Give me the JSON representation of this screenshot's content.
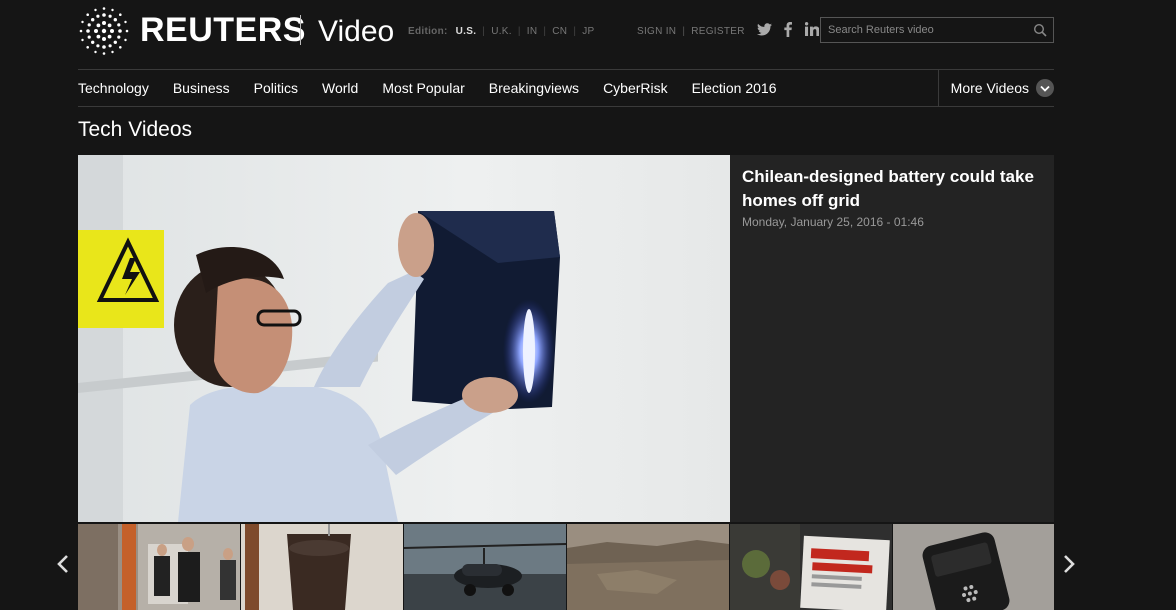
{
  "header": {
    "brand": "REUTERS",
    "section": "Video",
    "edition": {
      "label": "Edition:",
      "items": [
        "U.S.",
        "U.K.",
        "IN",
        "CN",
        "JP"
      ],
      "active": "U.S."
    },
    "auth": {
      "sign_in": "SIGN IN",
      "register": "REGISTER"
    },
    "social_icons": [
      "twitter-icon",
      "facebook-icon",
      "linkedin-icon"
    ],
    "search": {
      "placeholder": "Search Reuters video",
      "value": ""
    }
  },
  "nav": {
    "items": [
      "Technology",
      "Business",
      "Politics",
      "World",
      "Most Popular",
      "Breakingviews",
      "CyberRisk",
      "Election 2016"
    ],
    "more": "More Videos"
  },
  "page_title": "Tech Videos",
  "featured": {
    "headline": "Chilean-designed battery could take homes off grid",
    "date": "Monday, January 25, 2016 - 01:46"
  },
  "carousel": {
    "thumbnails": [
      "office-walk",
      "glass-of-water",
      "flying-car",
      "desert-landscape",
      "anti-bullying-newspaper",
      "blackberry-phone"
    ]
  },
  "colors": {
    "background": "#151515",
    "info_panel": "#232323",
    "divider": "#3a3a3a"
  }
}
